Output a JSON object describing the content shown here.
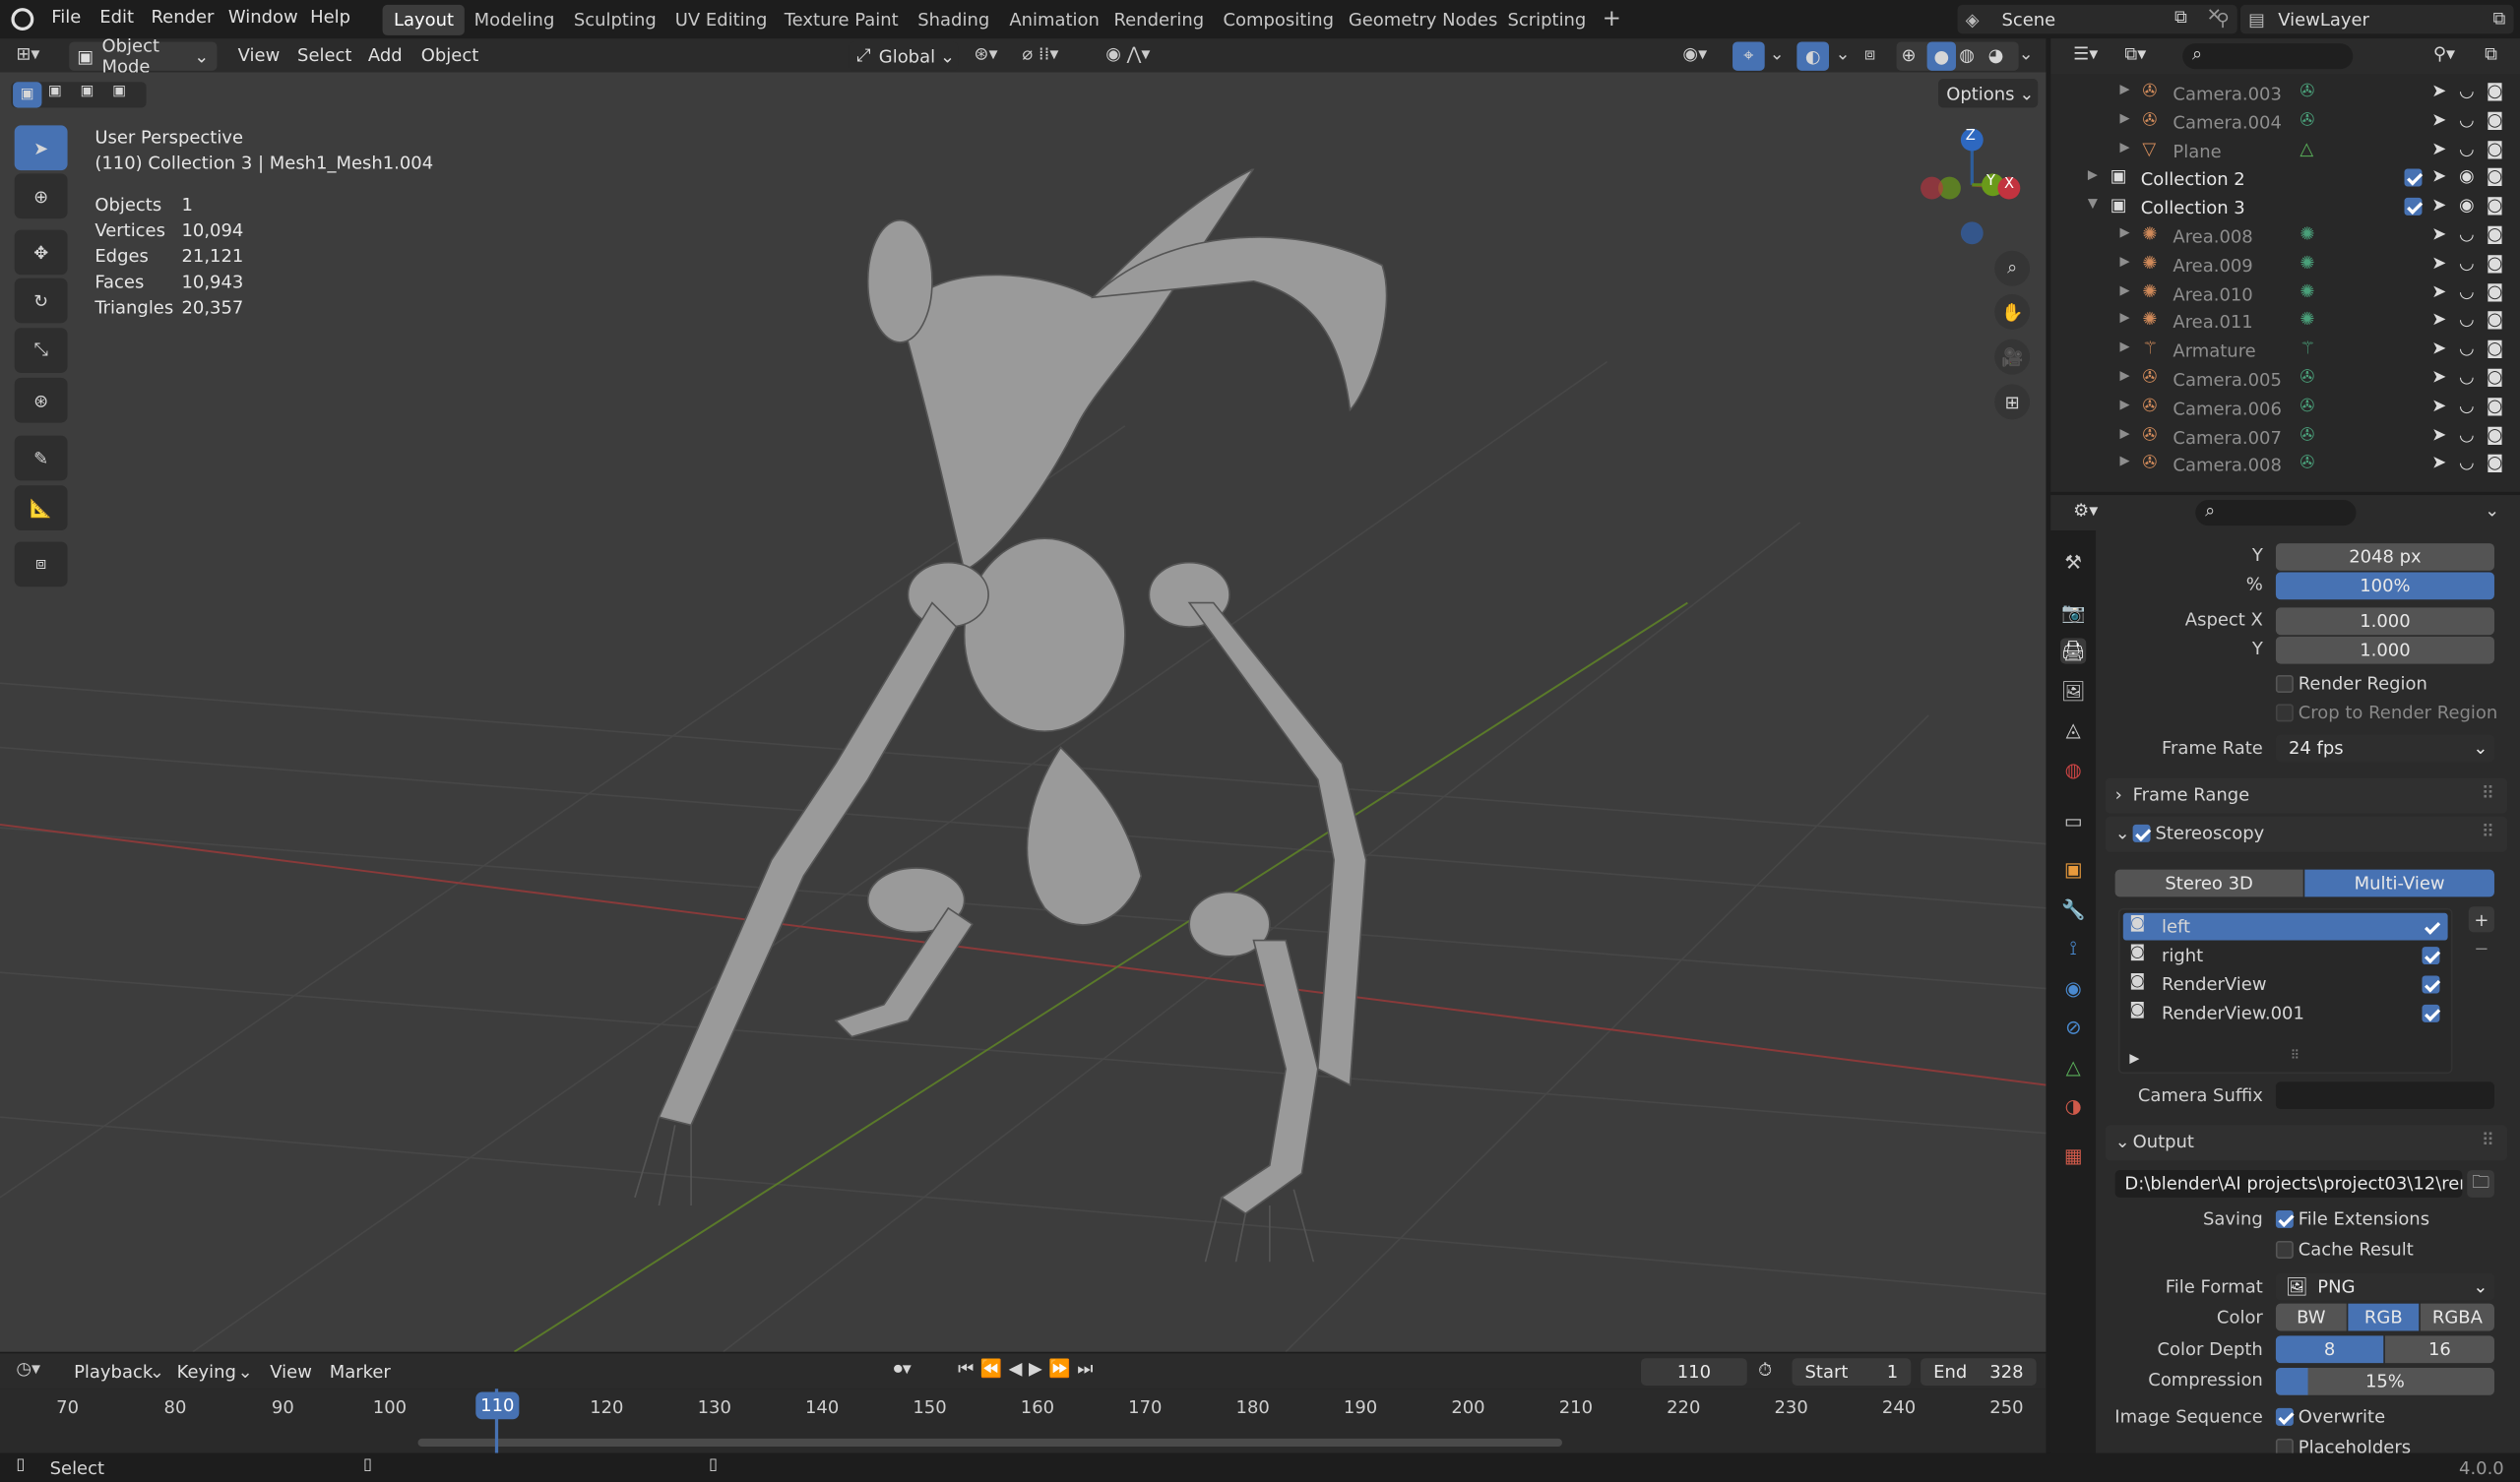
{
  "menu": {
    "items": [
      "File",
      "Edit",
      "Render",
      "Window",
      "Help"
    ]
  },
  "workspaces": {
    "tabs": [
      "Layout",
      "Modeling",
      "Sculpting",
      "UV Editing",
      "Texture Paint",
      "Shading",
      "Animation",
      "Rendering",
      "Compositing",
      "Geometry Nodes",
      "Scripting"
    ],
    "add": "+"
  },
  "scene": {
    "name": "Scene",
    "view_layer": "ViewLayer"
  },
  "viewport_header": {
    "mode": "Object Mode",
    "menus": [
      "View",
      "Select",
      "Add",
      "Object"
    ],
    "transform": "Global",
    "options": "Options"
  },
  "overlay": {
    "view": "User Perspective",
    "context": "(110) Collection 3 | Mesh1_Mesh1.004",
    "stats": [
      {
        "k": "Objects",
        "v": "1"
      },
      {
        "k": "Vertices",
        "v": "10,094"
      },
      {
        "k": "Edges",
        "v": "21,121"
      },
      {
        "k": "Faces",
        "v": "10,943"
      },
      {
        "k": "Triangles",
        "v": "20,357"
      }
    ]
  },
  "gizmo": {
    "z": "Z",
    "y": "Y",
    "x": "X"
  },
  "outliner": {
    "rows": [
      {
        "name": "Camera.003",
        "indent": 2,
        "type": "camera"
      },
      {
        "name": "Camera.004",
        "indent": 2,
        "type": "camera"
      },
      {
        "name": "Plane",
        "indent": 2,
        "type": "mesh"
      },
      {
        "name": "Collection 2",
        "indent": 1,
        "type": "collection"
      },
      {
        "name": "Collection 3",
        "indent": 1,
        "type": "collection"
      },
      {
        "name": "Area.008",
        "indent": 2,
        "type": "light"
      },
      {
        "name": "Area.009",
        "indent": 2,
        "type": "light"
      },
      {
        "name": "Area.010",
        "indent": 2,
        "type": "light"
      },
      {
        "name": "Area.011",
        "indent": 2,
        "type": "light"
      },
      {
        "name": "Armature",
        "indent": 2,
        "type": "armature"
      },
      {
        "name": "Camera.005",
        "indent": 2,
        "type": "camera"
      },
      {
        "name": "Camera.006",
        "indent": 2,
        "type": "camera"
      },
      {
        "name": "Camera.007",
        "indent": 2,
        "type": "camera"
      },
      {
        "name": "Camera.008",
        "indent": 2,
        "type": "camera"
      }
    ]
  },
  "properties": {
    "res_y_label": "Y",
    "res_y": "2048 px",
    "res_pct_label": "%",
    "res_pct": "100%",
    "aspect_x_label": "Aspect X",
    "aspect_x": "1.000",
    "aspect_y_label": "Y",
    "aspect_y": "1.000",
    "render_region": "Render Region",
    "crop": "Crop to Render Region",
    "frame_rate_label": "Frame Rate",
    "frame_rate": "24 fps",
    "frame_range": "Frame Range",
    "stereoscopy": "Stereoscopy",
    "stereo_3d": "Stereo 3D",
    "multi_view": "Multi-View",
    "views": [
      "left",
      "right",
      "RenderView",
      "RenderView.001"
    ],
    "camera_suffix": "Camera Suffix",
    "output": "Output",
    "output_path": "D:\\blender\\AI projects\\project03\\12\\ren...",
    "saving": "Saving",
    "file_ext": "File Extensions",
    "cache": "Cache Result",
    "file_format_label": "File Format",
    "file_format": "PNG",
    "color_label": "Color",
    "color_opts": [
      "BW",
      "RGB",
      "RGBA"
    ],
    "depth_label": "Color Depth",
    "depth_opts": [
      "8",
      "16"
    ],
    "compression_label": "Compression",
    "compression": "15%",
    "compression_value": 0.15,
    "image_seq": "Image Sequence",
    "overwrite": "Overwrite",
    "placeholders": "Placeholders"
  },
  "timeline": {
    "menus": [
      "Playback",
      "Keying",
      "View",
      "Marker"
    ],
    "current": "110",
    "start_label": "Start",
    "start": "1",
    "end_label": "End",
    "end": "328",
    "ticks": [
      "70",
      "80",
      "90",
      "100",
      "110",
      "120",
      "130",
      "140",
      "150",
      "160",
      "170",
      "180",
      "190",
      "200",
      "210",
      "220",
      "230",
      "240",
      "250"
    ]
  },
  "status": {
    "select": "Select",
    "version": "4.0.0"
  },
  "colors": {
    "accent": "#4772b3",
    "bg": "#3d3d3d",
    "panel": "#2b2b2b"
  }
}
